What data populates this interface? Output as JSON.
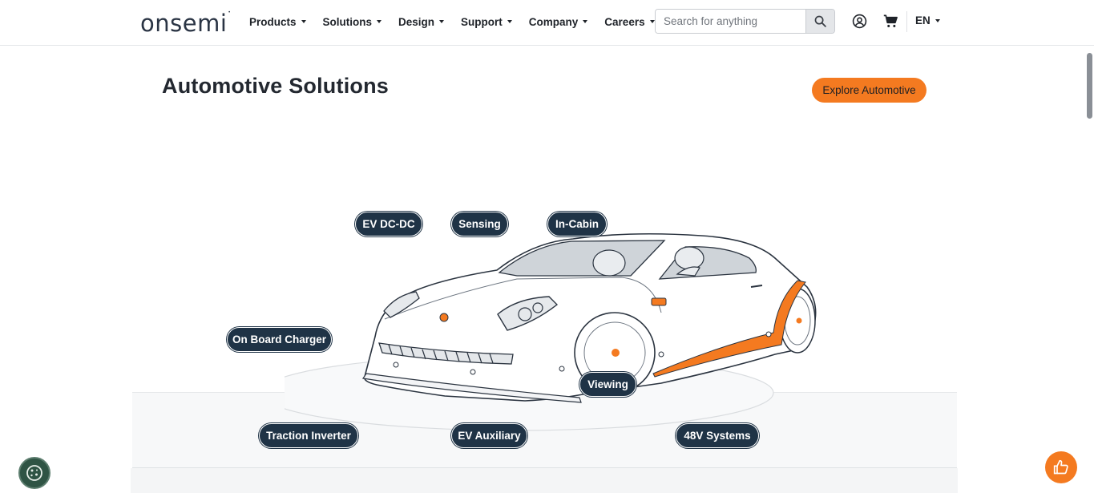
{
  "header": {
    "logo": "onsemi",
    "nav": [
      {
        "label": "Products"
      },
      {
        "label": "Solutions"
      },
      {
        "label": "Design"
      },
      {
        "label": "Support"
      },
      {
        "label": "Company"
      },
      {
        "label": "Careers"
      }
    ],
    "search": {
      "placeholder": "Search for anything"
    },
    "language": "EN",
    "icons": {
      "search": "search-icon",
      "account": "user-circle-icon",
      "cart": "cart-icon"
    }
  },
  "main": {
    "title": "Automotive Solutions",
    "explore_button": "Explore Automotive",
    "hotspots": [
      {
        "label": "EV DC-DC"
      },
      {
        "label": "Sensing"
      },
      {
        "label": "In-Cabin"
      },
      {
        "label": "On Board Charger"
      },
      {
        "label": "Viewing"
      },
      {
        "label": "Traction Inverter"
      },
      {
        "label": "EV Auxiliary"
      },
      {
        "label": "48V Systems"
      }
    ]
  },
  "floating": {
    "cookie": "cookie-icon",
    "feedback": "thumbs-up-icon"
  },
  "colors": {
    "accent": "#f47a20",
    "pill": "#1f3346",
    "text": "#232830"
  }
}
